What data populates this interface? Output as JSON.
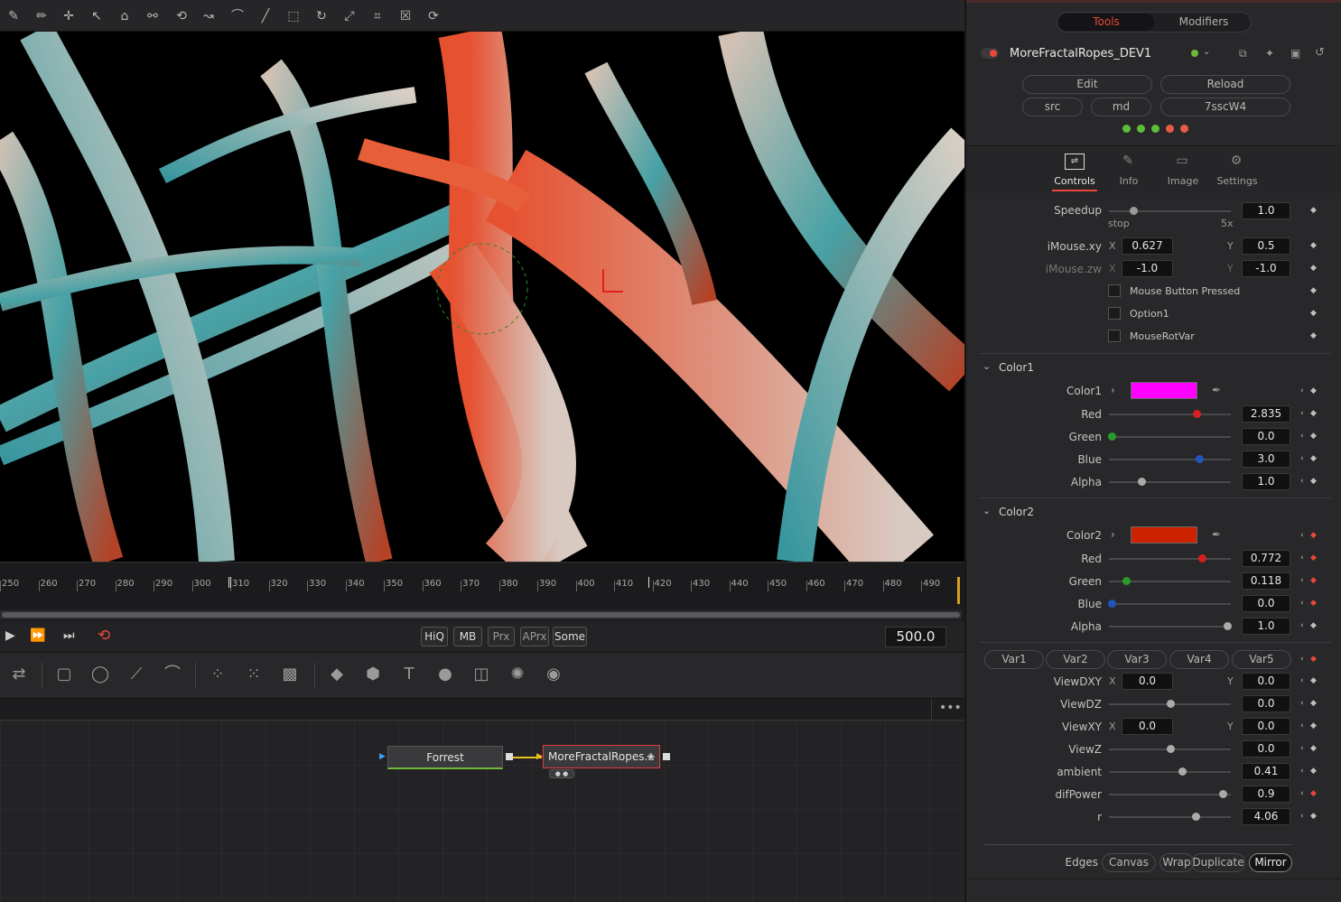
{
  "viewer_tools": [
    "select",
    "pen",
    "add-point",
    "bspline",
    "polyline",
    "wand",
    "lasso",
    "freehand",
    "curve",
    "line",
    "rect-select",
    "rotate",
    "transform",
    "crop",
    "close",
    "reset"
  ],
  "timeline": {
    "ticks": [
      "250",
      "260",
      "270",
      "280",
      "290",
      "300",
      "310",
      "320",
      "330",
      "340",
      "350",
      "360",
      "370",
      "380",
      "390",
      "400",
      "410",
      "420",
      "430",
      "440",
      "450",
      "460",
      "470",
      "480",
      "490"
    ]
  },
  "transport": {
    "buttons": [
      "HiQ",
      "MB",
      "Prx",
      "APrx",
      "Some"
    ],
    "frame": "500.0"
  },
  "nodes": {
    "source": "Forrest",
    "fuse": "MoreFractalRopes..."
  },
  "panel": {
    "tabs": {
      "tools": "Tools",
      "modifiers": "Modifiers"
    },
    "tool_name": "MoreFractalRopes_DEV1",
    "buttons": {
      "edit": "Edit",
      "reload": "Reload",
      "src": "src",
      "md": "md",
      "hash": "7sscW4"
    },
    "subtabs": {
      "controls": "Controls",
      "info": "Info",
      "image": "Image",
      "settings": "Settings"
    },
    "speedup": {
      "label": "Speedup",
      "value": "1.0",
      "min_label": "stop",
      "max_label": "5x",
      "level": 0.2
    },
    "imouse_xy": {
      "label": "iMouse.xy",
      "x_label": "X",
      "x": "0.627",
      "y_label": "Y",
      "y": "0.5"
    },
    "imouse_zw": {
      "label": "iMouse.zw",
      "x_label": "X",
      "x": "-1.0",
      "y_label": "Y",
      "y": "-1.0"
    },
    "checkboxes": [
      "Mouse Button Pressed",
      "Option1",
      "MouseRotVar"
    ],
    "color1": {
      "section": "Color1",
      "label": "Color1",
      "swatch": "#ff00ff",
      "rows": [
        {
          "label": "Red",
          "value": "2.835",
          "level": 0.72,
          "color": "#d42020"
        },
        {
          "label": "Green",
          "value": "0.0",
          "level": 0.02,
          "color": "#2a9a2a"
        },
        {
          "label": "Blue",
          "value": "3.0",
          "level": 0.74,
          "color": "#2255bb"
        },
        {
          "label": "Alpha",
          "value": "1.0",
          "level": 0.27,
          "color": "#aaaaaa"
        }
      ]
    },
    "color2": {
      "section": "Color2",
      "label": "Color2",
      "swatch": "#cc2200",
      "rows": [
        {
          "label": "Red",
          "value": "0.772",
          "level": 0.76,
          "color": "#d42020"
        },
        {
          "label": "Green",
          "value": "0.118",
          "level": 0.14,
          "color": "#2a9a2a"
        },
        {
          "label": "Blue",
          "value": "0.0",
          "level": 0.02,
          "color": "#2255bb"
        },
        {
          "label": "Alpha",
          "value": "1.0",
          "level": 0.97,
          "color": "#aaaaaa"
        }
      ]
    },
    "vars": [
      "Var1",
      "Var2",
      "Var3",
      "Var4",
      "Var5"
    ],
    "viewdxy": {
      "label": "ViewDXY",
      "x_label": "X",
      "x": "0.0",
      "y_label": "Y",
      "y": "0.0"
    },
    "viewdz": {
      "label": "ViewDZ",
      "value": "0.0",
      "level": 0.5
    },
    "viewxy": {
      "label": "ViewXY",
      "x_label": "X",
      "x": "0.0",
      "y_label": "Y",
      "y": "0.0"
    },
    "viewz": {
      "label": "ViewZ",
      "value": "0.0",
      "level": 0.5
    },
    "ambient": {
      "label": "ambient",
      "value": "0.41",
      "level": 0.6
    },
    "difpower": {
      "label": "difPower",
      "value": "0.9",
      "level": 0.93
    },
    "r": {
      "label": "r",
      "value": "4.06",
      "level": 0.71
    },
    "edges": {
      "label": "Edges",
      "options": [
        "Canvas",
        "Wrap",
        "Duplicate",
        "Mirror"
      ],
      "selected": "Mirror"
    }
  }
}
